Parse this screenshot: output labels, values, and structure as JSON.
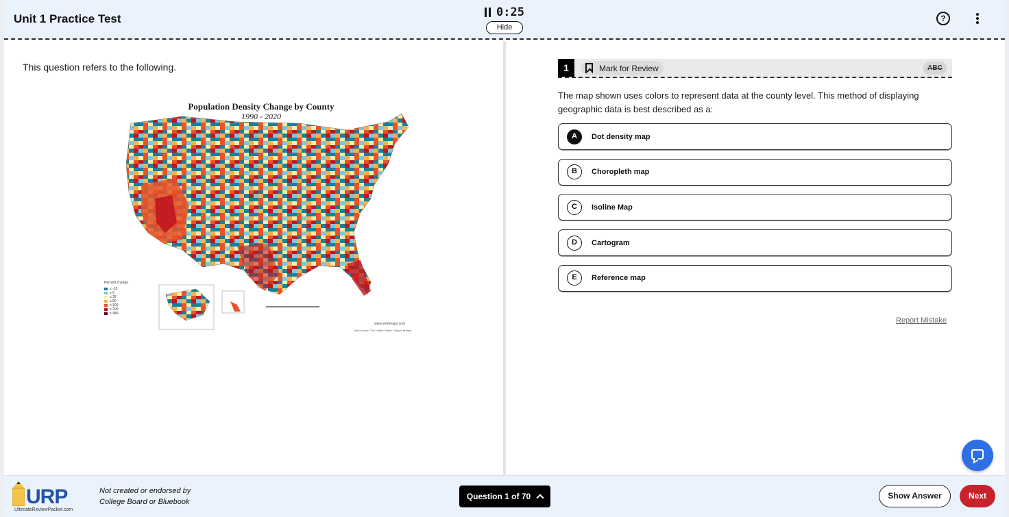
{
  "header": {
    "title": "Unit 1 Practice Test",
    "timer": "0:25",
    "hide_label": "Hide",
    "help_glyph": "?"
  },
  "left": {
    "refers_text": "This question refers to the following.",
    "map": {
      "title": "Population Density Change by County",
      "subtitle": "1990 - 2020",
      "legend_title": "Percent change",
      "legend": [
        {
          "label": "≤ -10",
          "color": "#1a7f9c"
        },
        {
          "label": "≤ 0",
          "color": "#7cc6de"
        },
        {
          "label": "≤ 25",
          "color": "#f7eea8"
        },
        {
          "label": "≤ 50",
          "color": "#f7b24b"
        },
        {
          "label": "≤ 100",
          "color": "#e8532a"
        },
        {
          "label": "≤ 200",
          "color": "#c0161f"
        },
        {
          "label": "≤ 486",
          "color": "#5b0a1a"
        }
      ],
      "credit": "www.vividmaps.com",
      "source": "Data source: The United States Census Bureau"
    }
  },
  "question": {
    "number": "1",
    "mark_label": "Mark for Review",
    "abc_label": "ABC",
    "text": "The map shown uses colors to represent data at the county level. This method of displaying geographic data is best described as a:",
    "options": [
      {
        "letter": "A",
        "text": "Dot density map"
      },
      {
        "letter": "B",
        "text": "Choropleth map"
      },
      {
        "letter": "C",
        "text": "Isoline Map"
      },
      {
        "letter": "D",
        "text": "Cartogram"
      },
      {
        "letter": "E",
        "text": "Reference map"
      }
    ],
    "selected": "A",
    "report_label": "Report Mistake"
  },
  "footer": {
    "logo_text": "URP",
    "logo_url": "UltimateReviewPacket.com",
    "disclaimer_line1": "Not created or endorsed by",
    "disclaimer_line2": "College Board or Bluebook",
    "question_nav": "Question 1 of 70",
    "show_answer": "Show Answer",
    "next": "Next"
  },
  "colors": {
    "accent_blue": "#2f6fe6",
    "next_red": "#c8232c",
    "header_bg": "#eaf2fb"
  },
  "icons": [
    "pause-icon",
    "help-icon",
    "more-vertical-icon",
    "bookmark-icon",
    "chat-icon",
    "chevron-up-icon",
    "pencil-icon"
  ]
}
